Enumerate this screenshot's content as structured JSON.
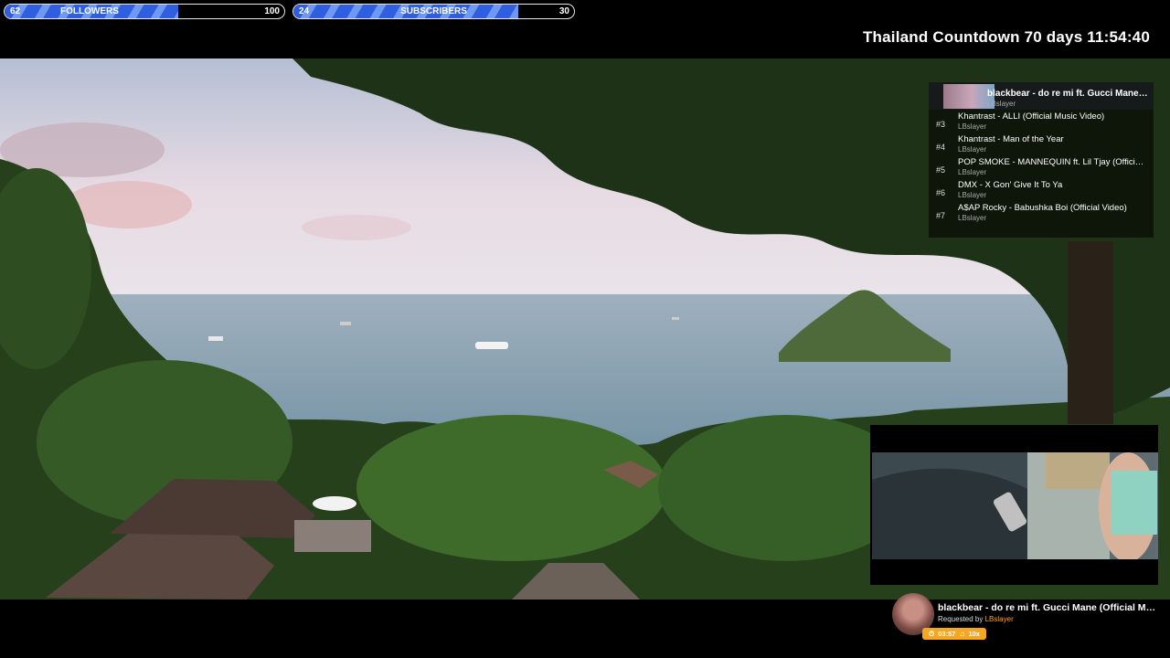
{
  "goals": {
    "followers": {
      "current": "62",
      "label": "FOLLOWERS",
      "target": "100",
      "progress": 0.62
    },
    "subscribers": {
      "current": "24",
      "label": "SUBSCRIBERS",
      "target": "30",
      "progress": 0.8
    }
  },
  "countdown": {
    "text": "Thailand Countdown 70 days 11:54:40"
  },
  "queue": {
    "current": {
      "title": "blackbear - do re mi ft. Gucci Mane (Official Music Video)",
      "requester": "LBslayer"
    },
    "items": [
      {
        "rank": "#3",
        "title": "Khantrast - ALLI (Official Music Video)",
        "requester": "LBslayer"
      },
      {
        "rank": "#4",
        "title": "Khantrast - Man of the Year",
        "requester": "LBslayer"
      },
      {
        "rank": "#5",
        "title": "POP SMOKE - MANNEQUIN ft. Lil Tjay (Official Lyric Video)",
        "requester": "LBslayer"
      },
      {
        "rank": "#6",
        "title": "DMX - X Gon' Give It To Ya",
        "requester": "LBslayer"
      },
      {
        "rank": "#7",
        "title": "A$AP Rocky - Babushka Boi (Official Video)",
        "requester": "LBslayer"
      }
    ]
  },
  "now_playing": {
    "title": "blackbear - do re mi ft. Gucci Mane (Official Music Video)",
    "requested_prefix": "Requested by",
    "requester": "LBslayer",
    "duration": "03:57",
    "volume": "10x",
    "duration_icon": "clock-icon",
    "volume_icon": "music-note-icon"
  },
  "colors": {
    "goal_fill": "#2f5fe0",
    "goal_stripe": "#6f98f2",
    "accent": "#f5a623"
  }
}
